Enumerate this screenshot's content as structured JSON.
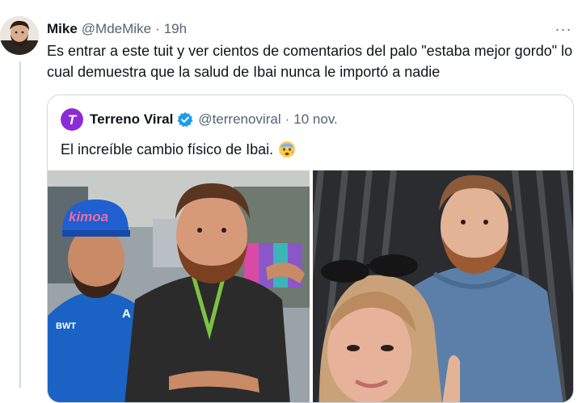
{
  "tweet": {
    "author_name": "Mike",
    "author_handle": "@MdeMike",
    "separator": "·",
    "time": "19h",
    "more_glyph": "···",
    "text": "Es entrar a este tuit y ver cientos de comentarios del palo \"estaba mejor gordo\" lo cual demuestra que la salud de Ibai nunca le importó a nadie"
  },
  "quote": {
    "author_name": "Terreno Viral",
    "author_handle": "@terrenoviral",
    "separator": "·",
    "date": "10 nov.",
    "text": "El increíble cambio físico de Ibai.",
    "emoji": "anxious-face-emoji",
    "logo_letter": "T",
    "cap_text": "kimoa",
    "shirt_text_1": "BWT",
    "shirt_text_2": "A"
  },
  "colors": {
    "verified_blue": "#1d9bf0",
    "brand_purple": "#8b2bd6",
    "secondary_text": "#536471",
    "border": "#cfd9de",
    "alpine_blue": "#1a63c4"
  }
}
